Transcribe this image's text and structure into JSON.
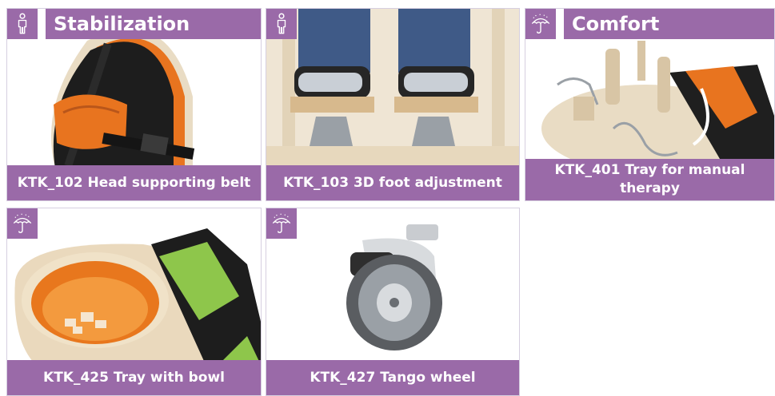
{
  "sections": {
    "stabilization": {
      "title": "Stabilization",
      "icon": "person-standing-icon"
    },
    "comfort": {
      "title": "Comfort",
      "icon": "umbrella-icon"
    }
  },
  "cards": [
    {
      "code_label": "KTK_102 Head supporting belt",
      "icon": "person-standing-icon",
      "image": "head-supporting-belt-photo"
    },
    {
      "code_label": "KTK_103  3D foot adjustment",
      "icon": "person-standing-icon",
      "image": "foot-adjustment-photo"
    },
    {
      "code_label": "KTK_401  Tray for manual therapy",
      "icon": "umbrella-icon",
      "image": "manual-therapy-tray-photo"
    },
    {
      "code_label": "KTK_425  Tray with bowl",
      "icon": "umbrella-icon",
      "image": "tray-with-bowl-photo"
    },
    {
      "code_label": "KTK_427  Tango wheel",
      "icon": "umbrella-icon",
      "image": "tango-wheel-photo"
    }
  ],
  "colors": {
    "accent": "#9a6aa8",
    "background": "#ffffff"
  }
}
